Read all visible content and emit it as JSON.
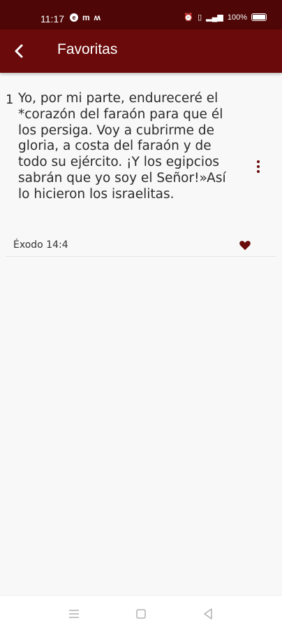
{
  "status_bar": {
    "time": "11:17",
    "notif_m": "m",
    "notif_ma": "ʍ",
    "battery_text": "100%"
  },
  "app_bar": {
    "title": "Favoritas"
  },
  "favorites": [
    {
      "number": "1",
      "text": "Yo, por mi parte, endureceré el *corazón del faraón para que él los persiga. Voy a cubrirme de gloria, a costa del faraón y de todo su ejército. ¡Y los egipcios sabrán que yo soy el Señor!»Así lo hicieron los israelitas.",
      "reference": "Éxodo 14:4"
    }
  ],
  "colors": {
    "primary": "#6a0a0a",
    "status_bar": "#4e0606",
    "background": "#f8f8f8"
  },
  "icons": {
    "back": "arrow-back-icon",
    "more": "more-vert-icon",
    "favorite": "heart-icon"
  }
}
